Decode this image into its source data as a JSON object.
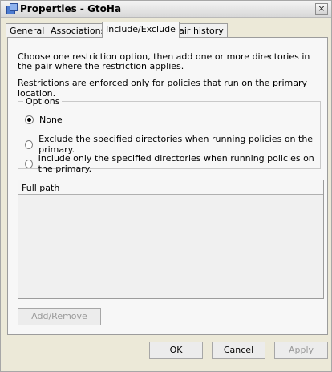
{
  "window": {
    "title": "Properties - GtoHa",
    "close_glyph": "×"
  },
  "tabs": [
    {
      "label": "General"
    },
    {
      "label": "Associations"
    },
    {
      "label": "Include/Exclude"
    },
    {
      "label": "Pair history"
    }
  ],
  "active_tab": "Include/Exclude",
  "content": {
    "intro_line1": "Choose one restriction option, then add one or more directories in the pair where the restriction applies.",
    "intro_line2": "Restrictions are enforced only for policies that run on the primary location.",
    "options_legend": "Options",
    "options": [
      {
        "label": "None",
        "checked": true
      },
      {
        "label": "Exclude the specified directories when running policies on the primary.",
        "checked": false
      },
      {
        "label": "Include only the specified directories when running policies on the primary.",
        "checked": false
      }
    ],
    "list_header": "Full path",
    "add_remove_label": "Add/Remove"
  },
  "footer": {
    "ok_label": "OK",
    "cancel_label": "Cancel",
    "apply_label": "Apply"
  }
}
